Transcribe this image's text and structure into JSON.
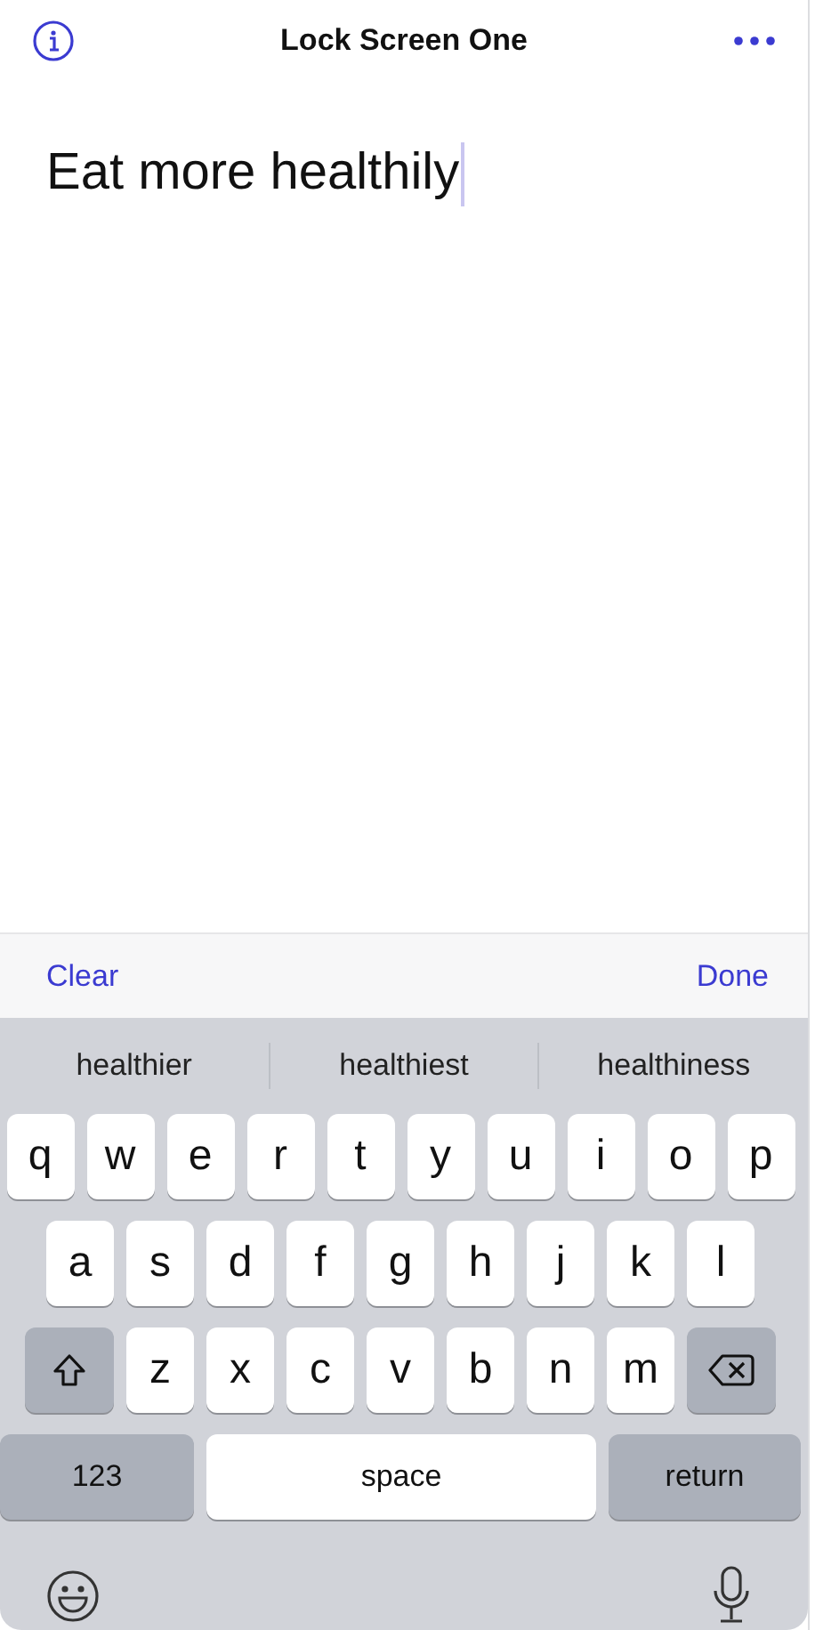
{
  "header": {
    "title": "Lock Screen One"
  },
  "note": {
    "value": "Eat more healthily",
    "focused": true
  },
  "toolbar": {
    "clear": "Clear",
    "done": "Done"
  },
  "suggestions": [
    "healthier",
    "healthiest",
    "healthiness"
  ],
  "keyboard": {
    "rows": [
      {
        "keys": [
          {
            "kind": "letter",
            "label": "q"
          },
          {
            "kind": "letter",
            "label": "w"
          },
          {
            "kind": "letter",
            "label": "e"
          },
          {
            "kind": "letter",
            "label": "r"
          },
          {
            "kind": "letter",
            "label": "t"
          },
          {
            "kind": "letter",
            "label": "y"
          },
          {
            "kind": "letter",
            "label": "u"
          },
          {
            "kind": "letter",
            "label": "i"
          },
          {
            "kind": "letter",
            "label": "o"
          },
          {
            "kind": "letter",
            "label": "p"
          }
        ]
      },
      {
        "keys": [
          {
            "kind": "letter",
            "label": "a"
          },
          {
            "kind": "letter",
            "label": "s"
          },
          {
            "kind": "letter",
            "label": "d"
          },
          {
            "kind": "letter",
            "label": "f"
          },
          {
            "kind": "letter",
            "label": "g"
          },
          {
            "kind": "letter",
            "label": "h"
          },
          {
            "kind": "letter",
            "label": "j"
          },
          {
            "kind": "letter",
            "label": "k"
          },
          {
            "kind": "letter",
            "label": "l"
          }
        ]
      },
      {
        "keys": [
          {
            "kind": "shift"
          },
          {
            "kind": "letter",
            "label": "z"
          },
          {
            "kind": "letter",
            "label": "x"
          },
          {
            "kind": "letter",
            "label": "c"
          },
          {
            "kind": "letter",
            "label": "v"
          },
          {
            "kind": "letter",
            "label": "b"
          },
          {
            "kind": "letter",
            "label": "n"
          },
          {
            "kind": "letter",
            "label": "m"
          },
          {
            "kind": "backspace"
          }
        ]
      }
    ],
    "bottom_row": {
      "numbers_key": "123",
      "space_key": "space",
      "return_key": "return"
    }
  }
}
